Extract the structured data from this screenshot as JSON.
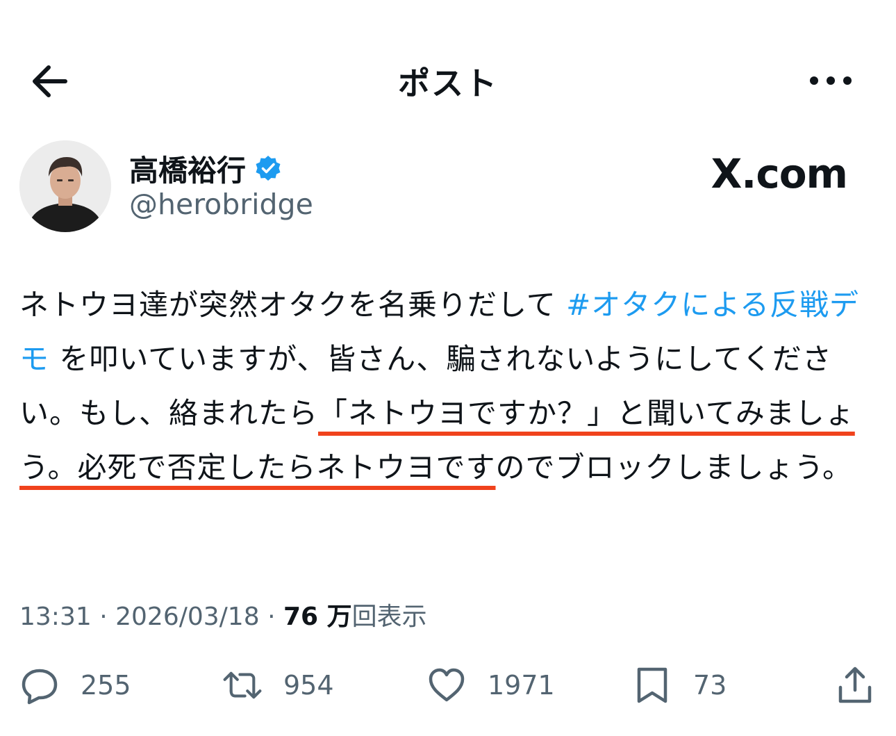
{
  "header": {
    "title": "ポスト",
    "back_icon": "arrow-left-icon",
    "more_icon": "more-horizontal-icon"
  },
  "author": {
    "display_name": "高橋裕行",
    "handle": "@herobridge",
    "verified": true,
    "verified_color": "#1d9bf0"
  },
  "watermark": "X.com",
  "tweet": {
    "segments": [
      {
        "text": "ネトウヨ達が突然オタクを名乗りだして ",
        "style": "plain"
      },
      {
        "text": "#オタクによる反戦デモ",
        "style": "hashtag"
      },
      {
        "text": " を叩いていますが、皆さん、騙されないようにしてください。もし、絡まれたら",
        "style": "plain"
      },
      {
        "text": "「ネトウヨですか？」と聞いてみましょう。",
        "style": "highlight"
      },
      {
        "text": "必死で否定したらネトウヨです",
        "style": "highlight"
      },
      {
        "text": "のでブロックしましょう。",
        "style": "plain"
      }
    ],
    "hashtag_color": "#1d9bf0",
    "highlight_color": "#f0421c"
  },
  "meta": {
    "time": "13:31",
    "separator": "·",
    "date": "2026/03/18",
    "views_count": "76 万",
    "views_label": "回表示"
  },
  "actions": {
    "replies": {
      "icon": "reply-icon",
      "count": "255"
    },
    "reposts": {
      "icon": "repost-icon",
      "count": "954"
    },
    "likes": {
      "icon": "heart-icon",
      "count": "1971"
    },
    "bookmarks": {
      "icon": "bookmark-icon",
      "count": "73"
    },
    "share": {
      "icon": "share-icon"
    }
  }
}
